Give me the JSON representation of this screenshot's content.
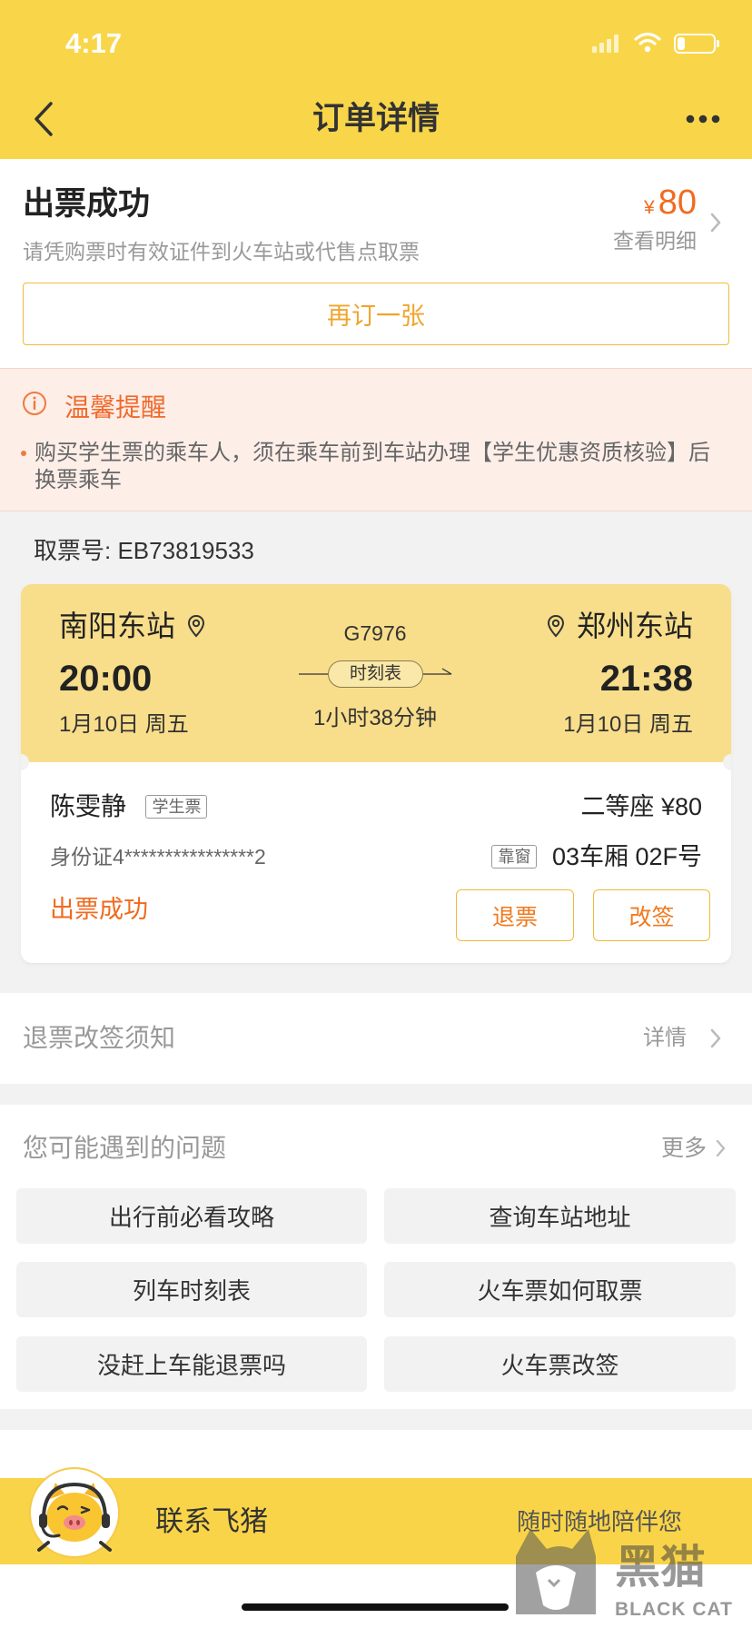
{
  "status_bar": {
    "time": "4:17",
    "battery_level": 0.2
  },
  "nav": {
    "title": "订单详情"
  },
  "order_status": {
    "title": "出票成功",
    "subtitle": "请凭购票时有效证件到火车站或代售点取票",
    "currency": "¥",
    "price": "80",
    "detail_link": "查看明细",
    "rebook_button": "再订一张"
  },
  "reminder": {
    "title": "温馨提醒",
    "text": "购买学生票的乘车人，须在乘车前到车站办理【学生优惠资质核验】后换票乘车"
  },
  "pickup": {
    "label": "取票号:",
    "code": "EB73819533"
  },
  "ticket": {
    "from_station": "南阳东站",
    "depart_time": "20:00",
    "depart_date": "1月10日 周五",
    "train_no": "G7976",
    "timetable_label": "时刻表",
    "duration": "1小时38分钟",
    "to_station": "郑州东站",
    "arrive_time": "21:38",
    "arrive_date": "1月10日 周五"
  },
  "passenger": {
    "name": "陈雯静",
    "ticket_type": "学生票",
    "seat_class_price": "二等座 ¥80",
    "id_number": "身份证4****************2",
    "seat_position": "靠窗",
    "seat_number": "03车厢 02F号",
    "status": "出票成功",
    "refund_button": "退票",
    "change_button": "改签"
  },
  "notice_row": {
    "label": "退票改签须知",
    "link": "详情"
  },
  "faq": {
    "title": "您可能遇到的问题",
    "more": "更多",
    "items": [
      "出行前必看攻略",
      "查询车站地址",
      "列车时刻表",
      "火车票如何取票",
      "没赶上车能退票吗",
      "火车票改签"
    ]
  },
  "contact_bar": {
    "label": "联系飞猪",
    "tagline": "随时随地陪伴您"
  },
  "watermark": {
    "cn": "黑猫",
    "en": "BLACK CAT"
  },
  "icons": {
    "back": "chevron-left-icon",
    "more": "more-dots-icon",
    "info": "info-icon",
    "location": "location-pin-icon",
    "chevron": "chevron-right-icon",
    "mascot": "fliggy-pig-mascot-icon"
  },
  "colors": {
    "brand_yellow": "#F9D649",
    "accent_orange": "#F26A1F",
    "ticket_yellow": "#F8DE8A",
    "reminder_bg": "#FDEEE8",
    "button_border": "#F0BD3A"
  }
}
